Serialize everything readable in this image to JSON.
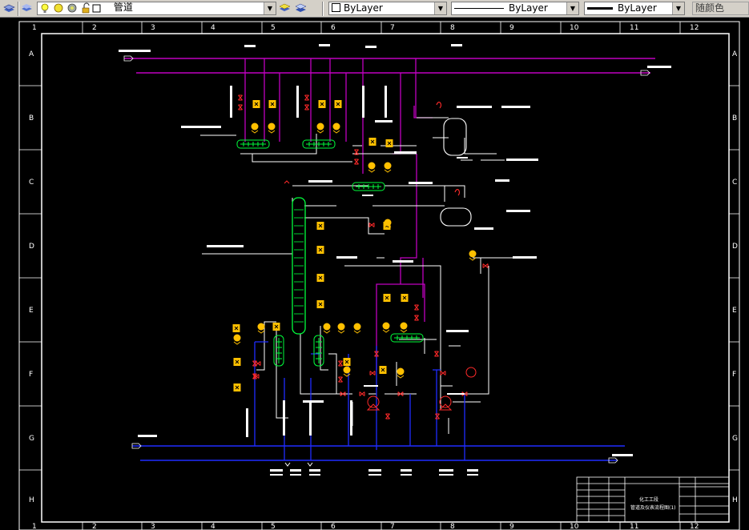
{
  "toolbar": {
    "layer_name": "管道",
    "color_control": "ByLayer",
    "linetype_control": "ByLayer",
    "lineweight_control": "ByLayer",
    "plotstyle_control": "随颜色"
  },
  "border": {
    "columns": [
      "1",
      "2",
      "3",
      "4",
      "5",
      "6",
      "7",
      "8",
      "9",
      "10",
      "11",
      "12"
    ],
    "rows": [
      "A",
      "B",
      "C",
      "D",
      "E",
      "F",
      "G",
      "H"
    ]
  },
  "title_block": {
    "line1": "化工工段",
    "line2": "管道及仪表流程图(1)"
  },
  "colors": {
    "magenta": "#c000c0",
    "white": "#ffffff",
    "blue": "#1f2cff",
    "green": "#00ff3c",
    "yellow": "#ffc000",
    "red": "#ff2a2a"
  }
}
